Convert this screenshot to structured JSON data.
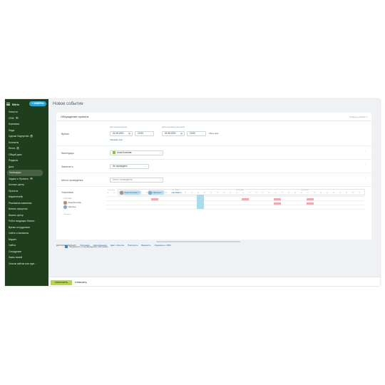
{
  "sidebar": {
    "logo": "Bitrix",
    "create_label": "+ ЗАВЕРШ",
    "items": [
      {
        "label": "Новости",
        "badge": ""
      },
      {
        "label": "CRM",
        "badge": "3"
      },
      {
        "label": "Компания",
        "badge": ""
      },
      {
        "label": "Лиды",
        "badge": ""
      },
      {
        "label": "Сделки Лидерство",
        "badge": "8"
      },
      {
        "label": "Контакты",
        "badge": ""
      },
      {
        "label": "Почта",
        "badge": "2"
      },
      {
        "label": "Общий диск",
        "badge": ""
      },
      {
        "label": "Разделы",
        "badge": ""
      },
      {
        "label": "Диск",
        "badge": ""
      },
      {
        "label": "Календарь",
        "badge": "",
        "active": true
      },
      {
        "label": "Задачи и Проекты",
        "badge": "3"
      },
      {
        "label": "Контакт-центр",
        "badge": ""
      },
      {
        "label": "Проекты",
        "badge": ""
      },
      {
        "label": "Маркетплейс",
        "badge": ""
      },
      {
        "label": "Рекламная кампания",
        "badge": ""
      },
      {
        "label": "Бизнес-процессы",
        "badge": ""
      },
      {
        "label": "Бизнес-центр",
        "badge": ""
      },
      {
        "label": "Робот входящих бизнес",
        "badge": ""
      },
      {
        "label": "Время сотрудников",
        "badge": ""
      },
      {
        "label": "Сайты и магазины",
        "badge": ""
      },
      {
        "label": "Маркет",
        "badge": ""
      },
      {
        "label": "Сайты",
        "badge": ""
      },
      {
        "label": "Сотрудники",
        "badge": ""
      },
      {
        "label": "Заказ новый",
        "badge": ""
      },
      {
        "label": "Список сайтов или груп...",
        "badge": ""
      }
    ]
  },
  "page": {
    "title": "Новое событие"
  },
  "event": {
    "name": "Обсуждение проекта",
    "advanced_label": "Открыть список"
  },
  "time": {
    "label": "Время",
    "from_caption": "дата начала начала",
    "to_caption": "дата окончания окончания",
    "from_date": "01.06.2021",
    "from_time": "12:00",
    "to_date": "01.06.2021",
    "to_time": "13:00",
    "allday_label": "Весь день",
    "timezone_link": "Часовой пояс"
  },
  "calendar": {
    "label": "Календарь",
    "value": "Анна Козлова",
    "color": "#7bd321"
  },
  "accessibility": {
    "label": "Занятость",
    "value": "Не проведено"
  },
  "location": {
    "label": "Место проведения",
    "value": "Место проведения"
  },
  "attendees": {
    "label": "Участники",
    "people": [
      "Анна Козлова",
      "Наталья"
    ],
    "add_label": "+ Добавить"
  },
  "planner": {
    "caption": "Участники",
    "names": [
      "Анна Козлова",
      "Наталья"
    ],
    "days": [
      "пт 4 июня",
      "пн 7 июня",
      "вт 8 июня",
      "ср 9 июня"
    ],
    "hours": [
      "10",
      "11",
      "12",
      "13",
      "14",
      "15",
      "16",
      "17",
      "18",
      "19",
      "10",
      "11",
      "12",
      "13",
      "14",
      "15",
      "16",
      "17",
      "18",
      "19",
      "10",
      "11",
      "12",
      "13",
      "14",
      "15",
      "16",
      "17",
      "18",
      "19",
      "10",
      "11",
      "12",
      "13",
      "14",
      "15",
      "16",
      "17",
      "18",
      "19"
    ],
    "footnote": "Занятость",
    "notify_label": "Уведомлять о подтверждении участников"
  },
  "more": {
    "title": "ДОПОЛНИТЕЛЬНО:",
    "links": [
      "Описание",
      "Напоминание",
      "Цвет события",
      "Повторять",
      "Важность",
      "Привязка к CRM"
    ]
  },
  "footer": {
    "save_label": "СОХРАНИТЬ",
    "cancel_label": "ОТМЕНИТЬ"
  }
}
